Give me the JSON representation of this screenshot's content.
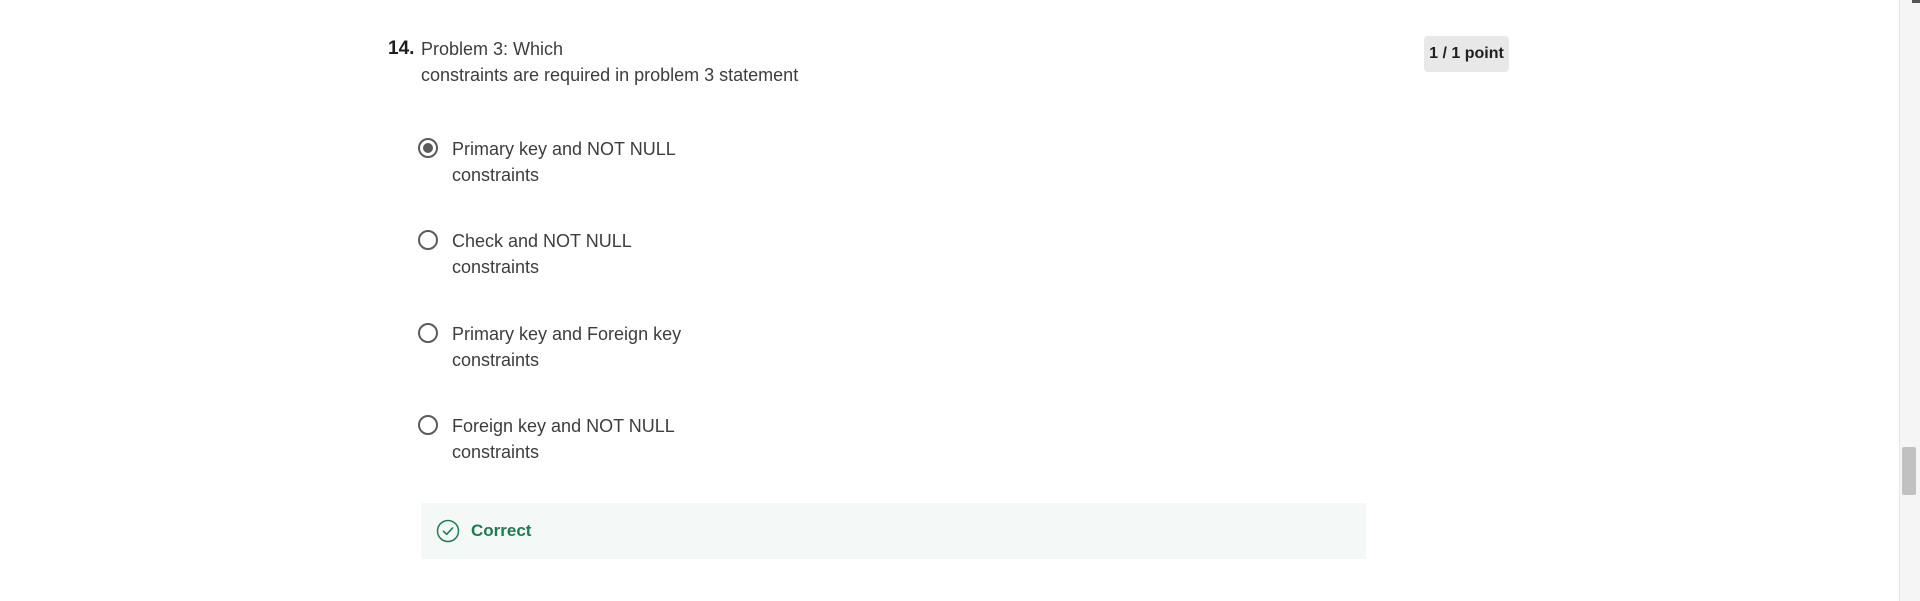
{
  "question": {
    "number": "14.",
    "text_line1": "Problem 3: Which",
    "text_line2": "constraints are required in problem 3 statement",
    "points": "1 / 1 point"
  },
  "options": [
    {
      "line1": "Primary key and NOT NULL",
      "line2": "constraints",
      "selected": true
    },
    {
      "line1": "Check and NOT NULL",
      "line2": "constraints",
      "selected": false
    },
    {
      "line1": "Primary key and Foreign key",
      "line2": "constraints",
      "selected": false
    },
    {
      "line1": "Foreign key and NOT NULL",
      "line2": "constraints",
      "selected": false
    }
  ],
  "feedback": {
    "label": "Correct",
    "icon": "check-circle-icon",
    "color": "#1d7c50"
  }
}
